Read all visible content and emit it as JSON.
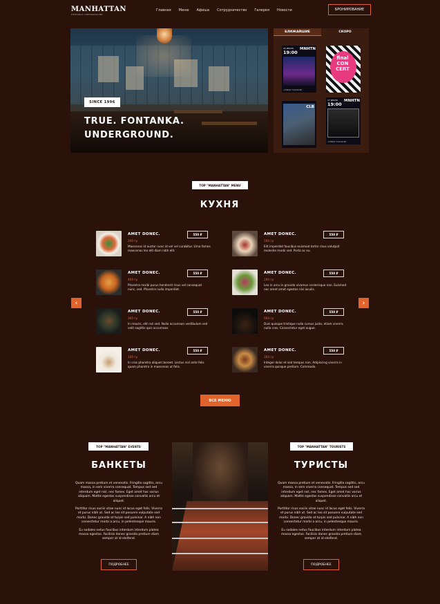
{
  "header": {
    "logo_text": "MANHATTAN",
    "logo_tagline": "FONTANKA UNDERGROUND",
    "nav": [
      "Главная",
      "Меню",
      "Афиша",
      "Сотрудничество",
      "Галерея",
      "Новости"
    ],
    "book_label": "БРОНИРОВАНИЕ"
  },
  "hero": {
    "badge": "SINCE 1996",
    "title_line1": "TRUE. FONTANKA.",
    "title_line2": "UNDERGROUND."
  },
  "events": {
    "tab_near": "БЛИЖАЙШИЕ",
    "tab_soon": "СКОРО",
    "posters": [
      {
        "date": "20 ИЮЛЯ",
        "time": "19:00",
        "brand": "MNHTN",
        "footer": "+7(812) 713-19-45"
      },
      {
        "date": "",
        "time": "",
        "brand": "",
        "art_text": "final CON CERT",
        "footer": ""
      },
      {
        "date": "",
        "time": "",
        "brand": "CLB",
        "footer": ""
      },
      {
        "date": "17 ИЮЛЯ",
        "time": "19:00",
        "brand": "MNHTN",
        "footer": "+7(812) 713-19-45"
      }
    ]
  },
  "menu": {
    "tag": "TOP \"MANHATTAN\" MENU",
    "title": "КУХНЯ",
    "left": [
      {
        "name": "AMET DONEC.",
        "weight": "200 гр",
        "price": "550 ₽",
        "desc": "Maecenas id auctor nunc id vel vel curabitur. Urna fames maecenas leo elit diam nibh elit."
      },
      {
        "name": "AMET DONEC.",
        "weight": "400 гр",
        "price": "550 ₽",
        "desc": "Pharetra morbi purus hendrerit risus vel consequat nunc, sed. Pharetra nulla imperdiet."
      },
      {
        "name": "AMET DONEC.",
        "weight": "300 гр",
        "price": "550 ₽",
        "desc": "In mauris, elit nisl sed. Nulla accumsan vestibulum sed velit sagittis quis accumsan."
      },
      {
        "name": "AMET DONEC.",
        "weight": "100 гр",
        "price": "550 ₽",
        "desc": "In cras pharetra aliquet laoreet. Lectus nisl ante felis quam pharetra in maecenas ut felis."
      }
    ],
    "right": [
      {
        "name": "AMET DONEC.",
        "weight": "500 гр",
        "price": "550 ₽",
        "desc": "Elit imperdiet faucibus euismod tortor risus volutpat molestie morbi sed. Porta ac eu."
      },
      {
        "name": "AMET DONEC.",
        "weight": "200 гр",
        "price": "550 ₽",
        "desc": "Leo in arcu in gravida vivamus scelerisque non. Euismod nec amet amet egestas nisi iaculis."
      },
      {
        "name": "AMET DONEC.",
        "weight": "600 гр",
        "price": "550 ₽",
        "desc": "Duis quisque tristique nulla cursus justo, etiam viverra nulla cras. Consectetur eget augue."
      },
      {
        "name": "AMET DONEC.",
        "weight": "300 гр",
        "price": "550 ₽",
        "desc": "Integer dolor et sed tempus non. Adipiscing viverra in viverra quisque pretium. Commodo."
      }
    ],
    "all_label": "ВСЕ МЕНЮ"
  },
  "banquets": {
    "tag": "TOP \"MANHATTAN\" EVENTS",
    "title": "БАНКЕТЫ",
    "p1": "Quam massa pretium et venenatis. Fringilla sagittis, arcu massa, in sem viverra consequat. Tempus sed sed interdum eget nisl, nec fames. Eget amet hac varius aliquam. Mattis egestas suspendisse convallis arcu et aliquet.",
    "p2": "Porttitor risus sociis vitae nunc id lacus eget felis. Viverra et purus nibh ut. Sed ac leo sit posuere vulputate sed morbi. Donec gravida at turpis sed pulvinar. A nibh non consectetur morbi a arcu, in pelentesque mauris.",
    "p3": "Eu sodales netus faucibus interdum interdum platea massa egestas. Facilisis donec gravida pretium diam semper at id eleifend.",
    "button": "ПОДРОБНЕЕ"
  },
  "tourists": {
    "tag": "TOP \"MANHATTAN\" TOURISTS",
    "title": "ТУРИСТЫ",
    "p1": "Quam massa pretium et venenatis. Fringilla sagittis, arcu massa, in sem viverra consequat. Tempus sed sed interdum eget nisl, nec fames. Eget amet hac varius aliquam. Mattis egestas suspendisse convallis arcu et aliquet.",
    "p2": "Porttitor risus sociis vitae nunc id lacus eget felis. Viverra et purus nibh ut. Sed ac leo sit posuere vulputate sed morbi. Donec gravida at turpis sed pulvinar. A nibh non consectetur morbi a arcu, in pelentesque mauris.",
    "p3": "Eu sodales netus faucibus interdum interdum platea massa egestas. Facilisis donec gravida pretium diam semper at id eleifend.",
    "button": "ПОДРОБНЕЕ"
  },
  "colors": {
    "accent": "#e0642b",
    "background": "#2a120b"
  }
}
